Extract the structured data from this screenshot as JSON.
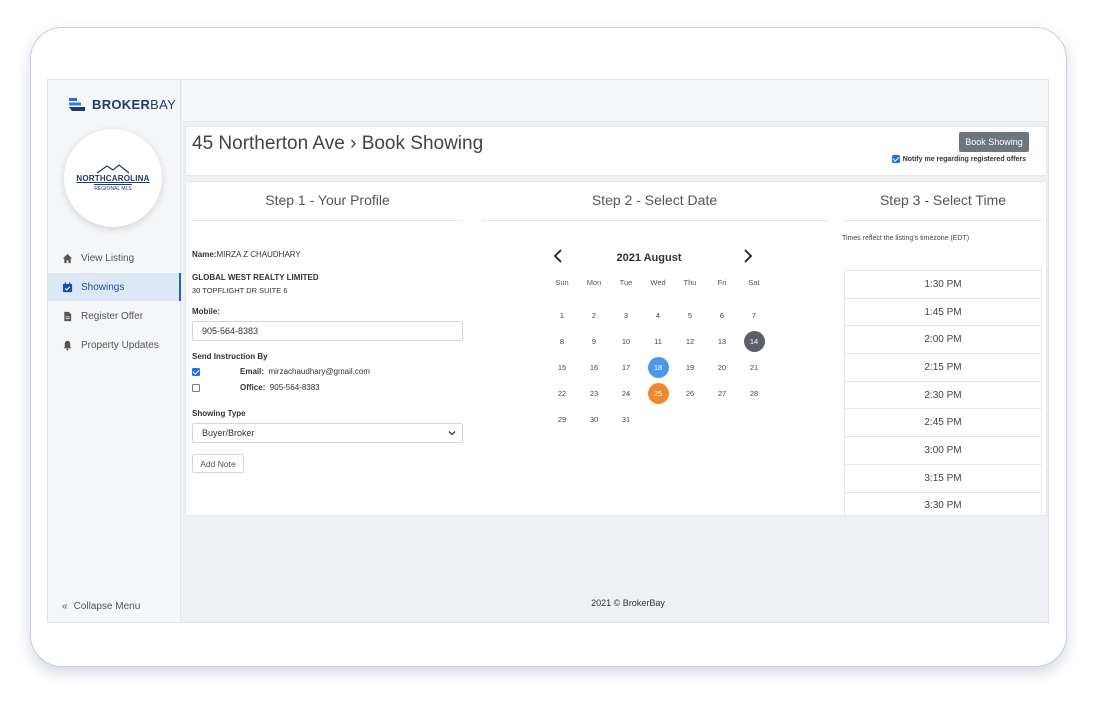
{
  "brand": {
    "bold": "BROKER",
    "light": "BAY",
    "accent": "#1f6fd1"
  },
  "mls": {
    "line1": "NORTHCAROLINA",
    "line2": "REGIONAL MLS"
  },
  "sidebar": {
    "items": [
      {
        "label": "View Listing",
        "icon": "home-icon"
      },
      {
        "label": "Showings",
        "icon": "calendar-check-icon",
        "active": true
      },
      {
        "label": "Register Offer",
        "icon": "document-icon"
      },
      {
        "label": "Property Updates",
        "icon": "bell-icon"
      }
    ],
    "collapse_label": "Collapse Menu",
    "collapse_glyph": "«"
  },
  "header": {
    "title": "45 Northerton Ave › Book Showing",
    "book_button": "Book Showing",
    "notify_label": "Notify me regarding registered offers"
  },
  "step1": {
    "title": "Step 1 - Your Profile",
    "name_label": "Name:",
    "name_value": "MIRZA Z CHAUDHARY",
    "company": "GLOBAL WEST REALTY LIMITED",
    "address": "30 TOPFLIGHT DR SUITE 6",
    "mobile_label": "Mobile:",
    "mobile_value": "905-564-8383",
    "send_label": "Send Instruction By",
    "email_label": "Email:",
    "email_value": "mirzachaudhary@gmail.com",
    "office_label": "Office:",
    "office_value": "905-564-8383",
    "showing_type_label": "Showing Type",
    "showing_type_value": "Buyer/Broker",
    "add_note": "Add Note"
  },
  "step2": {
    "title": "Step 2 - Select Date",
    "month_label": "2021 August",
    "weekdays": [
      "Sun",
      "Mon",
      "Tue",
      "Wed",
      "Thu",
      "Fri",
      "Sat"
    ],
    "selected_day": 18,
    "today_day": 25,
    "hover_day": 14,
    "first_weekday_offset": 0,
    "days_in_month": 31
  },
  "step3": {
    "title": "Step 3 - Select Time",
    "tz_note": "Times reflect the listing's timezone (EDT)",
    "times": [
      "1:30 PM",
      "1:45 PM",
      "2:00 PM",
      "2:15 PM",
      "2:30 PM",
      "2:45 PM",
      "3:00 PM",
      "3:15 PM",
      "3:30 PM"
    ]
  },
  "footer": "2021 © BrokerBay"
}
